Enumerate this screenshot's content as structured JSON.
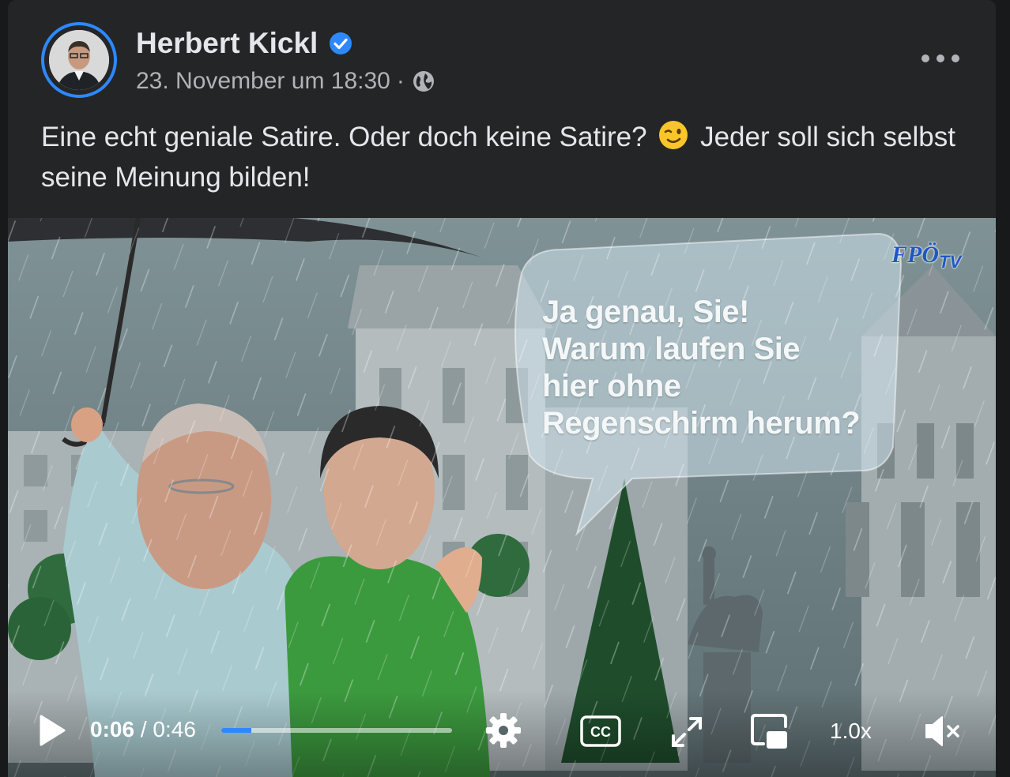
{
  "post": {
    "author": "Herbert Kickl",
    "timestamp": "23. November um 18:30",
    "separator": "·",
    "audience_icon": "globe-icon",
    "verified_icon": "verified-badge-icon",
    "more_icon": "more-options-icon",
    "text_part1": "Eine echt geniale Satire. Oder doch keine Satire?",
    "emoji": "winking-face-emoji",
    "text_part2": "Jeder soll sich selbst seine Meinung bilden!"
  },
  "video": {
    "speech_bubble_lines": [
      "Ja genau, Sie!",
      "Warum laufen Sie",
      "hier ohne",
      "Regenschirm herum?"
    ],
    "logo_main": "FPÖ",
    "logo_sub": "TV",
    "controls": {
      "current_time": "0:06",
      "time_separator": " / ",
      "duration": "0:46",
      "progress_fraction": 0.13,
      "speed": "1.0x",
      "play_icon": "play-icon",
      "settings_icon": "gear-icon",
      "captions_icon": "cc-icon",
      "fullscreen_icon": "fullscreen-icon",
      "pip_icon": "picture-in-picture-icon",
      "mute_icon": "muted-speaker-icon"
    }
  },
  "colors": {
    "background": "#18191a",
    "card": "#242526",
    "accent": "#2d88ff",
    "primary_text": "#e4e6eb",
    "secondary_text": "#b0b3b8"
  }
}
